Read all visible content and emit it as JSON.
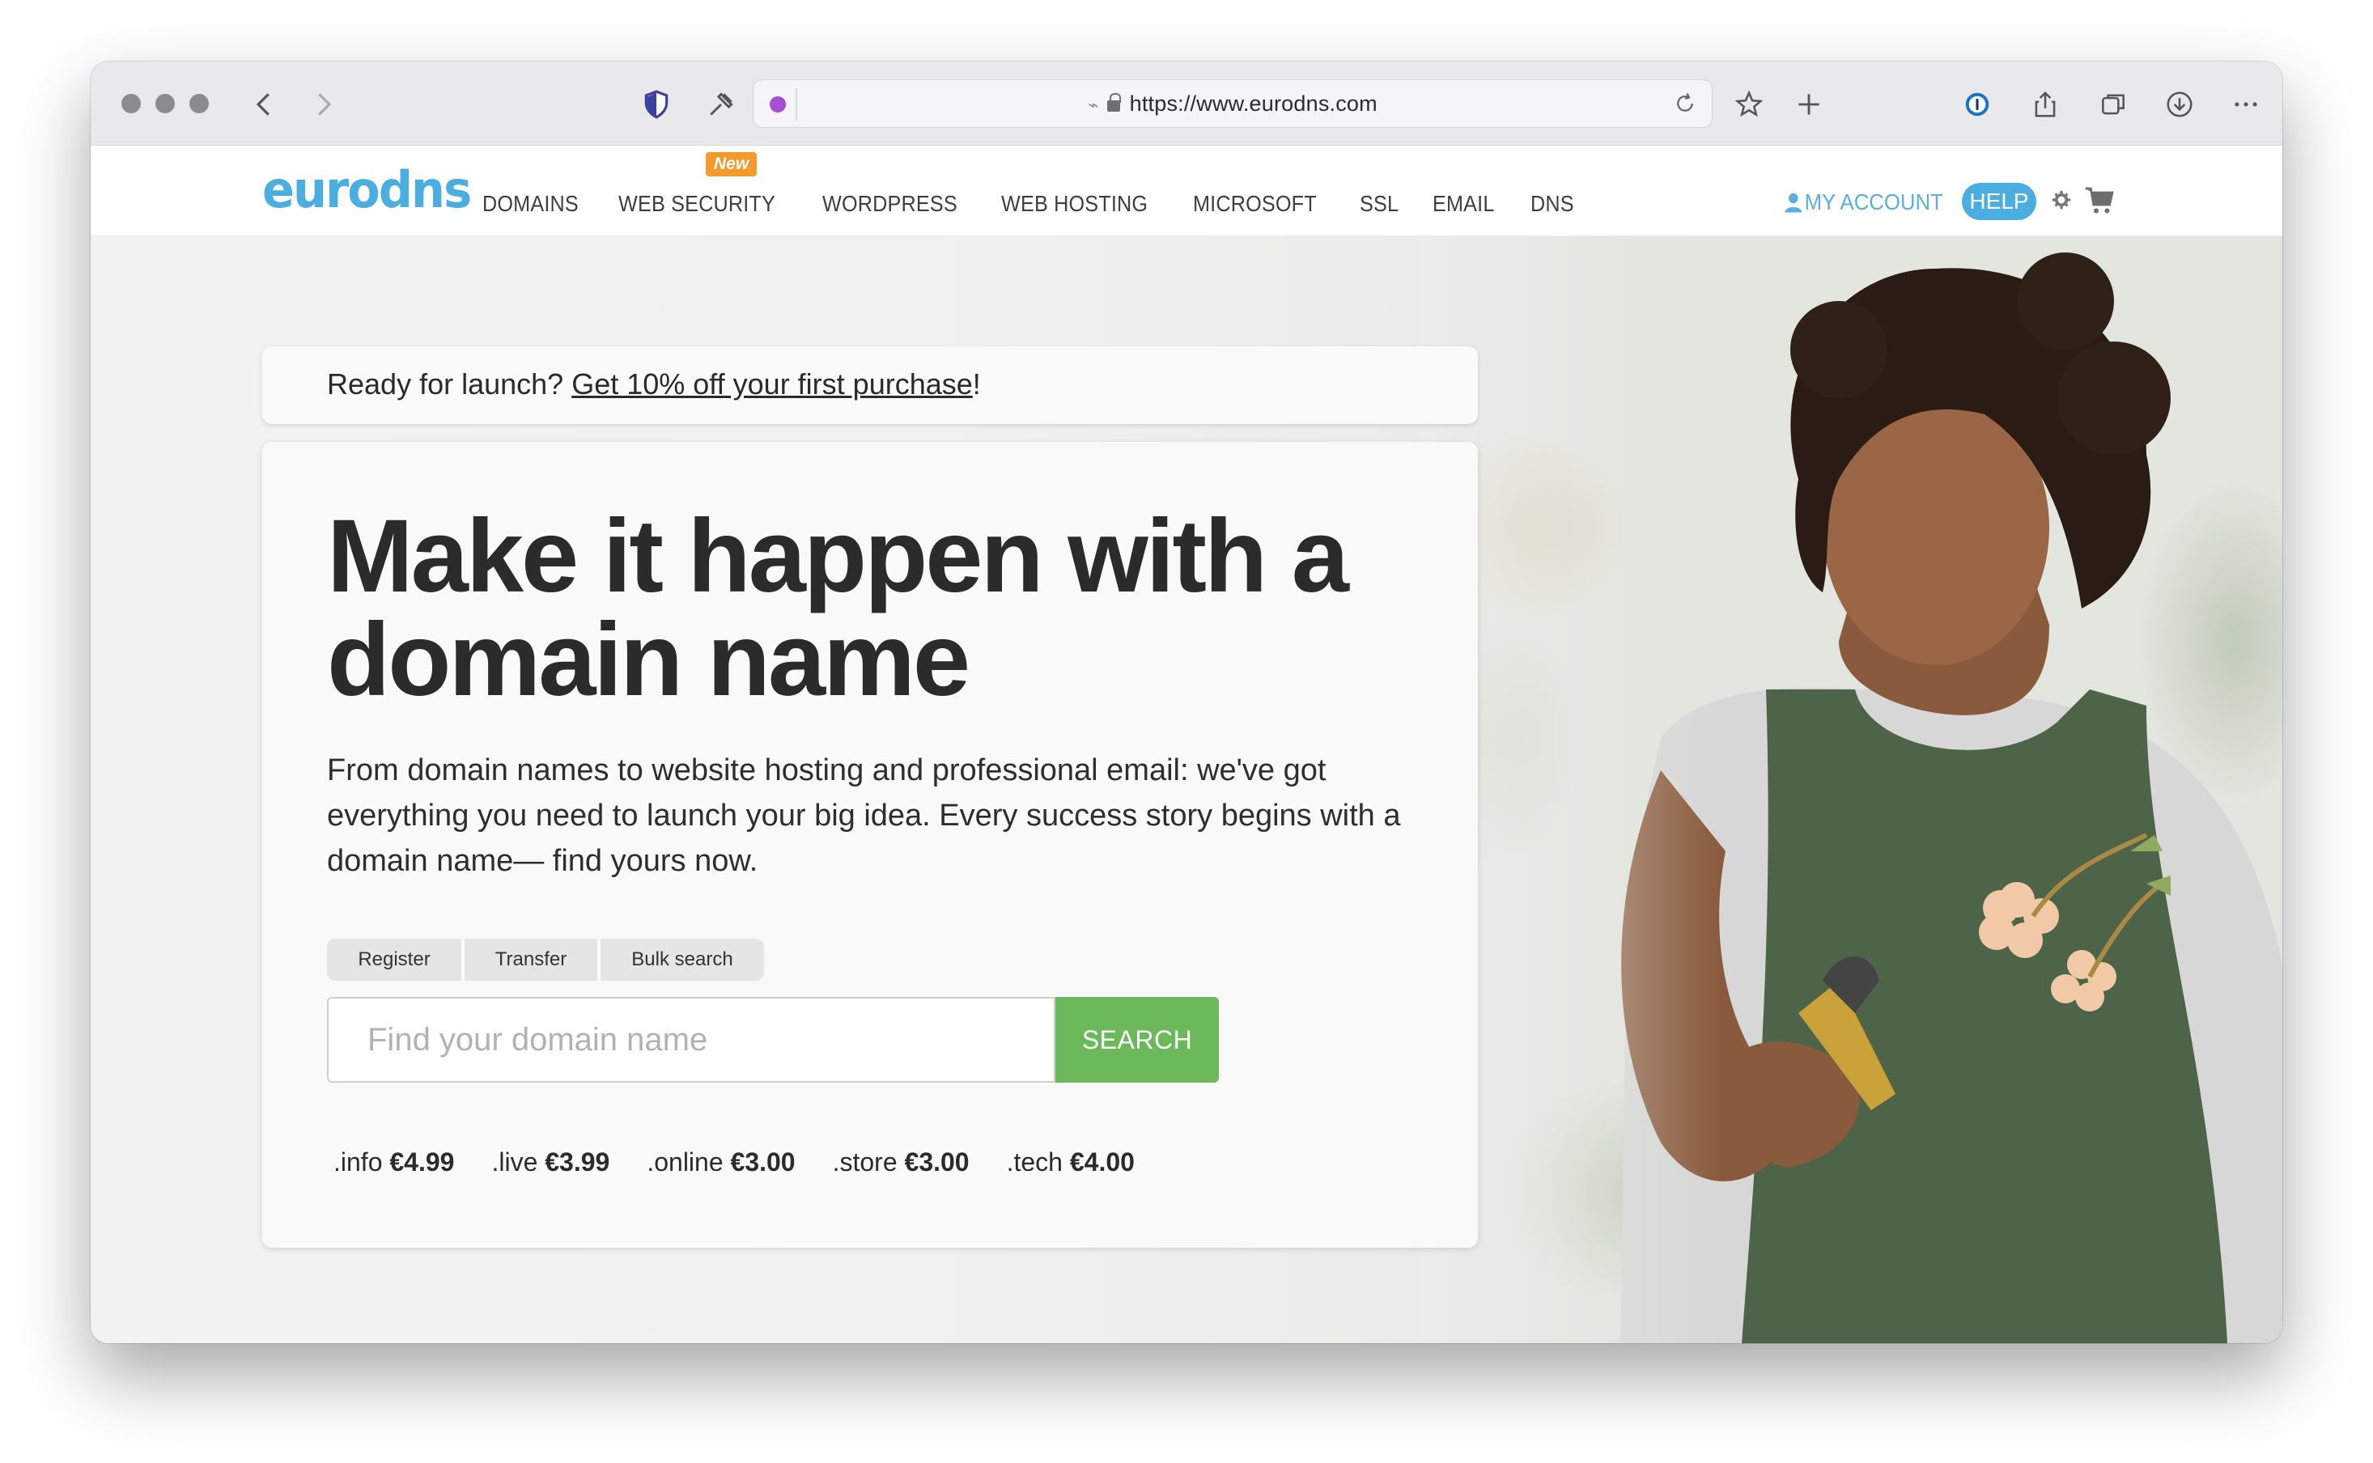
{
  "browser": {
    "url": "https://www.eurodns.com"
  },
  "site": {
    "logo": "eurodns",
    "nav": [
      {
        "label": "DOMAINS"
      },
      {
        "label": "WEB SECURITY"
      },
      {
        "label": "WORDPRESS"
      },
      {
        "label": "WEB HOSTING"
      },
      {
        "label": "MICROSOFT"
      },
      {
        "label": "SSL"
      },
      {
        "label": "EMAIL"
      },
      {
        "label": "DNS"
      }
    ],
    "new_badge": "New",
    "account_label": "MY ACCOUNT",
    "help_label": "HELP"
  },
  "promo": {
    "lead": "Ready for launch? ",
    "link": "Get 10% off your first purchase",
    "tail": "!"
  },
  "hero": {
    "headline": "Make it happen with a domain name",
    "subtext": "From domain names to website hosting and professional email: we've got everything you need to launch your big idea. Every success story begins with a domain name— find yours now.",
    "tabs": [
      {
        "label": "Register"
      },
      {
        "label": "Transfer"
      },
      {
        "label": "Bulk search"
      }
    ],
    "search_placeholder": "Find your domain name",
    "search_button": "SEARCH",
    "prices": [
      {
        "tld": ".info",
        "price": "€4.99"
      },
      {
        "tld": ".live",
        "price": "€3.99"
      },
      {
        "tld": ".online",
        "price": "€3.00"
      },
      {
        "tld": ".store",
        "price": "€3.00"
      },
      {
        "tld": ".tech",
        "price": "€4.00"
      }
    ]
  },
  "colors": {
    "brand": "#4aaee0",
    "search_button": "#6cb95c",
    "new_badge": "#f39a2b"
  }
}
